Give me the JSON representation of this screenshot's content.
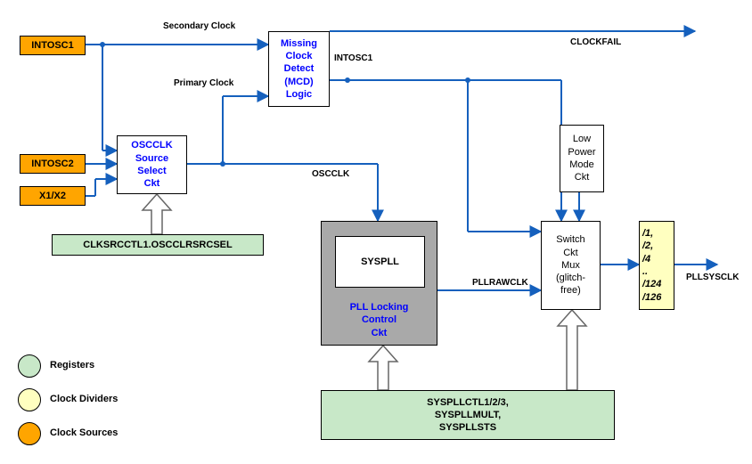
{
  "sources": {
    "intosc1": "INTOSC1",
    "intosc2": "INTOSC2",
    "x1x2": "X1/X2"
  },
  "blocks": {
    "oscclk_sel": "OSCCLK\nSource\nSelect\nCkt",
    "mcd": "Missing\nClock\nDetect\n(MCD)\nLogic",
    "syspll": "SYSPLL",
    "pll_lock": "PLL Locking\nControl\nCkt",
    "lpm": "Low\nPower\nMode\nCkt",
    "switch": "Switch\nCkt\nMux\n(glitch-\nfree)",
    "divider": "/1,\n/2,\n/4\n..\n/124\n/126"
  },
  "registers": {
    "clksrc": "CLKSRCCTL1.OSCCLRSRCSEL",
    "syspllreg": "SYSPLLCTL1/2/3,\nSYSPLLMULT,\nSYSPLLSTS"
  },
  "signals": {
    "secondary": "Secondary Clock",
    "primary": "Primary Clock",
    "intosc1_out": "INTOSC1",
    "oscclk": "OSCCLK",
    "pllrawclk": "PLLRAWCLK",
    "clockfail": "CLOCKFAIL",
    "pllsysclk": "PLLSYSCLK"
  },
  "legend": {
    "registers": "Registers",
    "dividers": "Clock Dividers",
    "sources": "Clock Sources"
  }
}
